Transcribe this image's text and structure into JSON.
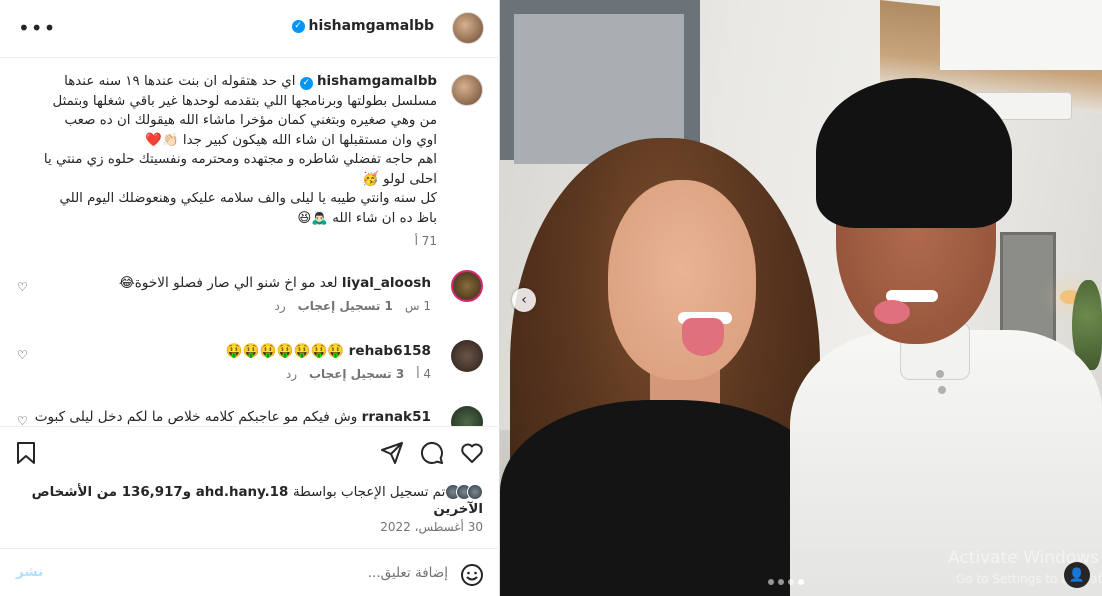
{
  "header": {
    "username": "hishamgamalbb",
    "more_icon": "more-horizontal-icon"
  },
  "caption": {
    "username": "hishamgamalbb",
    "lines": [
      "اي حد هتقوله ان بنت عندها ١٩ سنه عندها",
      "مسلسل بطولتها وبرنامجها اللي بتقدمه لوحدها غير باقي شغلها وبتمثل",
      "من وهي صغيره وبتغني كمان مؤخرا ماشاء الله هيقولك ان ده صعب",
      "اوي وان مستقبلها ان شاء الله هيكون كبير جدا 👏🏻❤️",
      "اهم حاجه تفضلي شاطره و مجتهده ومحترمه ونفسيتك حلوه زي منتي يا",
      "احلى لولو 🥳",
      "",
      "كل سنه وانتي طيبه يا ليلى والف سلامه عليكي وهنعوضلك اليوم اللي",
      "باظ ده ان شاء الله 🙇🏻‍♂️😆"
    ],
    "time": "71 أ"
  },
  "comments": [
    {
      "username": "liyal_aloosh",
      "text": "لعد مو اخ شنو الي صار فصلو الاخوة😂",
      "time": "1 س",
      "likes": "1 تسجيل إعجاب",
      "reply": "رد"
    },
    {
      "username": "rehab6158",
      "text": "🤑🤑🤑🤑🤑🤑🤑",
      "time": "4 أ",
      "likes": "3 تسجيل إعجاب",
      "reply": "رد"
    },
    {
      "username": "rranak51",
      "text": "وش فيكم مو عاجبكم كلامه خلاص ما لكم دخل ليلى كبوت",
      "time": "",
      "likes": "",
      "reply": ""
    }
  ],
  "likes_line": {
    "lead": "تم تسجيل الإعجاب بواسطة",
    "user": "ahd.hany.18",
    "rest": "و136,917 من الأشخاص الآخرين"
  },
  "post_date": "30 أغسطس، 2022",
  "add_comment": {
    "placeholder": "إضافة تعليق...",
    "post_label": "نشر"
  },
  "watermark": {
    "title": "Activate Windows",
    "subtitle": "Go to Settings to activate Windows."
  },
  "icons": {
    "like": "heart-icon",
    "comment": "comment-icon",
    "share": "send-icon",
    "save": "bookmark-icon",
    "emoji": "emoji-icon",
    "prev": "chevron-left-icon",
    "user_tag": "user-tag-icon"
  },
  "carousel": {
    "slides": 4,
    "active_index": 3
  },
  "colors": {
    "accent": "#0095f6",
    "text": "#262626",
    "muted": "#737373"
  }
}
